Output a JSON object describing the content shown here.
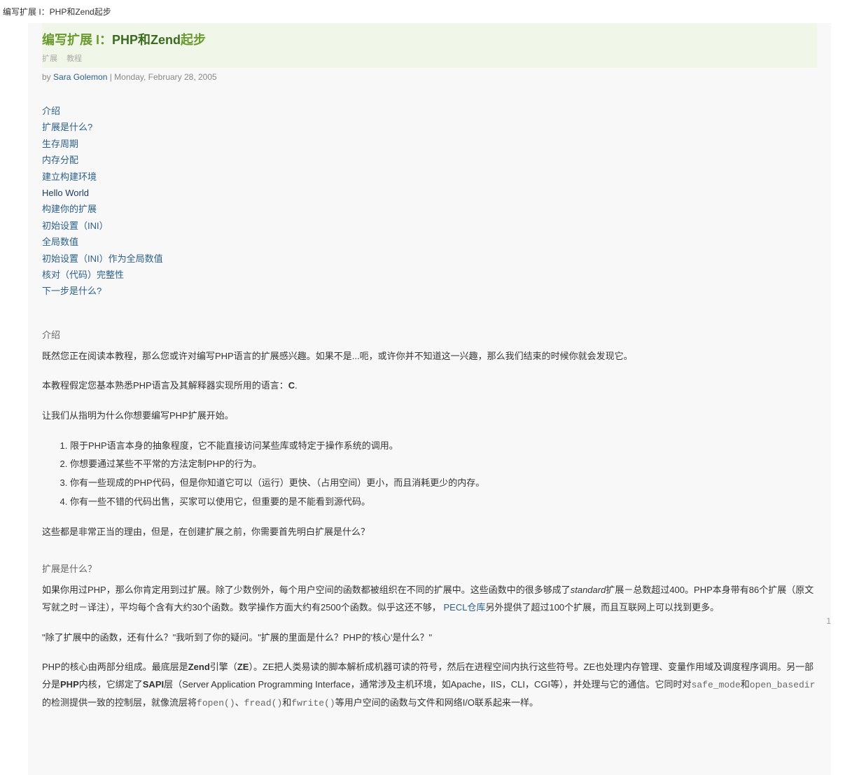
{
  "header": {
    "breadcrumb": "编写扩展 I：PHP和Zend起步"
  },
  "title": {
    "prefix": "编写扩展 I：",
    "highlight": "PHP和Zend",
    "suffix": "起步"
  },
  "tags": {
    "tag1": "扩展",
    "tag2": "教程"
  },
  "byline": {
    "by": "by ",
    "author": "Sara Golemon",
    "date": " | Monday, February 28, 2005"
  },
  "toc": {
    "items": [
      {
        "label": "介绍",
        "active": false
      },
      {
        "label": "扩展是什么?",
        "active": false
      },
      {
        "label": "生存周期",
        "active": false
      },
      {
        "label": "内存分配",
        "active": false
      },
      {
        "label": "建立构建环境",
        "active": false
      },
      {
        "label": "Hello World",
        "active": true
      },
      {
        "label": "构建你的扩展",
        "active": false
      },
      {
        "label": "初始设置（INI）",
        "active": false
      },
      {
        "label": "全局数值",
        "active": false
      },
      {
        "label": "初始设置（INI）作为全局数值",
        "active": false
      },
      {
        "label": "核对（代码）完整性",
        "active": false
      },
      {
        "label": "下一步是什么?",
        "active": false
      }
    ]
  },
  "section_intro": {
    "heading": "介绍",
    "p1": "既然您正在阅读本教程，那么您或许对编写PHP语言的扩展感兴趣。如果不是...呃，或许你并不知道这一兴趣，那么我们结束的时候你就会发现它。",
    "p2_pre": "本教程假定您基本熟悉PHP语言及其解释器实现所用的语言：",
    "p2_bold": "C",
    "p2_post": ".",
    "p3": "让我们从指明为什么你想要编写PHP扩展开始。",
    "list": [
      "限于PHP语言本身的抽象程度，它不能直接访问某些库或特定于操作系统的调用。",
      "你想要通过某些不平常的方法定制PHP的行为。",
      "你有一些现成的PHP代码，但是你知道它可以（运行）更快、（占用空间）更小，而且消耗更少的内存。",
      "你有一些不错的代码出售，买家可以使用它，但重要的是不能看到源代码。"
    ],
    "p4": "这些都是非常正当的理由，但是，在创建扩展之前，你需要首先明白扩展是什么？"
  },
  "section_what": {
    "heading": "扩展是什么？",
    "p1_a": "如果你用过PHP，那么你肯定用到过扩展。除了少数例外，每个用户空间的函数都被组织在不同的扩展中。这些函数中的很多够成了",
    "p1_italic": "standard",
    "p1_b": "扩展－总数超过400。PHP本身带有86个扩展（原文写就之时－译注），平均每个含有大约30个函数。数学操作方面大约有2500个函数。似乎这还不够， ",
    "p1_link": "PECL仓库",
    "p1_c": "另外提供了超过100个扩展，而且互联网上可以找到更多。",
    "p2": "\"除了扩展中的函数，还有什么？\"我听到了你的疑问。\"扩展的里面是什么？PHP的'核心'是什么？\"",
    "p3_a": "PHP的核心由两部分组成。最底层是",
    "p3_b1": "Zend",
    "p3_b": "引擎（",
    "p3_b2": "ZE",
    "p3_c": "）。ZE把人类易读的脚本解析成机器可读的符号，然后在进程空间内执行这些符号。ZE也处理内存管理、变量作用域及调度程序调用。另一部分是",
    "p3_b3": "PHP",
    "p3_d": "内核，它绑定了",
    "p3_b4": "SAPI",
    "p3_e": "层（Server Application Programming Interface，通常涉及主机环境，如Apache，IIS，CLI，CGI等），并处理与它的通信。它同时对",
    "p3_code1": "safe_mode",
    "p3_f": "和",
    "p3_code2": "open_basedir",
    "p3_g": "的检测提供一致的控制层，就像流层将",
    "p3_code3": "fopen()",
    "p3_h": "、",
    "p3_code4": "fread()",
    "p3_i": "和",
    "p3_code5": "fwrite()",
    "p3_j": "等用户空间的函数与文件和网络I/O联系起来一样。"
  },
  "page_number": "1"
}
